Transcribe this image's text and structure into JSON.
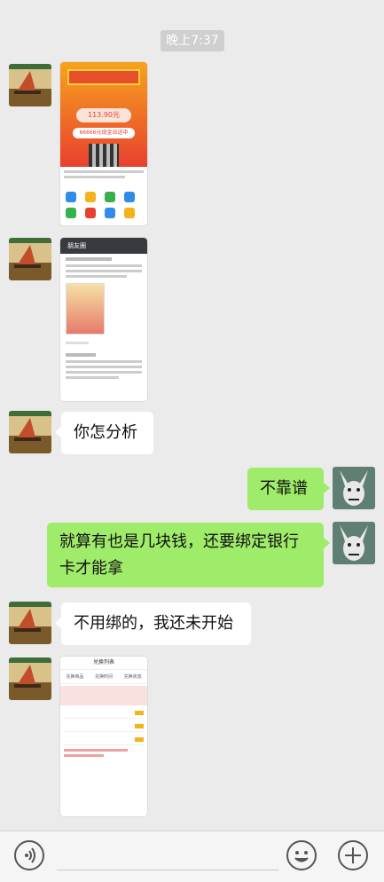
{
  "timestamp": "晚上7:37",
  "messages": [
    {
      "side": "left",
      "kind": "image",
      "desc": "promo-screenshot"
    },
    {
      "side": "left",
      "kind": "image",
      "desc": "moments-screenshot"
    },
    {
      "side": "left",
      "kind": "text",
      "text": "你怎分析"
    },
    {
      "side": "right",
      "kind": "text",
      "text": "不靠谱"
    },
    {
      "side": "right",
      "kind": "text",
      "text": "就算有也是几块钱，还要绑定银行卡才能拿"
    },
    {
      "side": "left",
      "kind": "text",
      "text": "不用绑的，我还未开始"
    },
    {
      "side": "left",
      "kind": "image",
      "desc": "exchange-list-screenshot"
    }
  ],
  "thumb1": {
    "amount": "113.90元",
    "cash": "66666元现金派送中"
  },
  "thumb2": {
    "header": "朋友圈"
  },
  "thumb3": {
    "header": "兑换列表",
    "cols": [
      "兑换商品",
      "兑换时间",
      "兑换状态"
    ]
  },
  "colors": {
    "bg": "#ebebeb",
    "sent_bubble": "#9feb6a",
    "received_bubble": "#ffffff"
  },
  "toolbar": {
    "voice_icon": "voice-icon",
    "emoji_icon": "emoji-icon",
    "plus_icon": "plus-icon"
  }
}
